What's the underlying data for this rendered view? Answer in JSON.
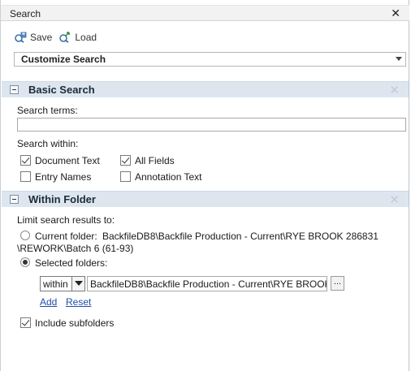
{
  "window": {
    "title": "Search",
    "close_glyph": "✕"
  },
  "toolbar": {
    "save_label": "Save",
    "load_label": "Load",
    "save_icon": "save-icon",
    "load_icon": "load-icon"
  },
  "customize": {
    "selected": "Customize Search"
  },
  "basic": {
    "title": "Basic Search",
    "close_glyph": "✕",
    "search_terms_label": "Search terms:",
    "search_terms_value": "",
    "search_within_label": "Search within:",
    "options": [
      {
        "label": "Document Text",
        "checked": true
      },
      {
        "label": "All Fields",
        "checked": true
      },
      {
        "label": "Entry Names",
        "checked": false
      },
      {
        "label": "Annotation Text",
        "checked": false
      }
    ]
  },
  "folder": {
    "title": "Within Folder",
    "close_glyph": "✕",
    "limit_label": "Limit search results to:",
    "current_folder_label": "Current folder:",
    "current_folder_path_line1": "BackfileDB8\\Backfile Production - Current\\RYE BROOK  286831",
    "current_folder_path_line2": "\\REWORK\\Batch 6 (61-93)",
    "selected_folders_label": "Selected folders:",
    "selected_option": "selected",
    "within_value": "within",
    "path_value": "BackfileDB8\\Backfile Production - Current\\RYE BROOK",
    "browse_label": "...",
    "add_label": "Add",
    "reset_label": "Reset",
    "include_subfolders_label": "Include subfolders",
    "include_subfolders_checked": true
  }
}
